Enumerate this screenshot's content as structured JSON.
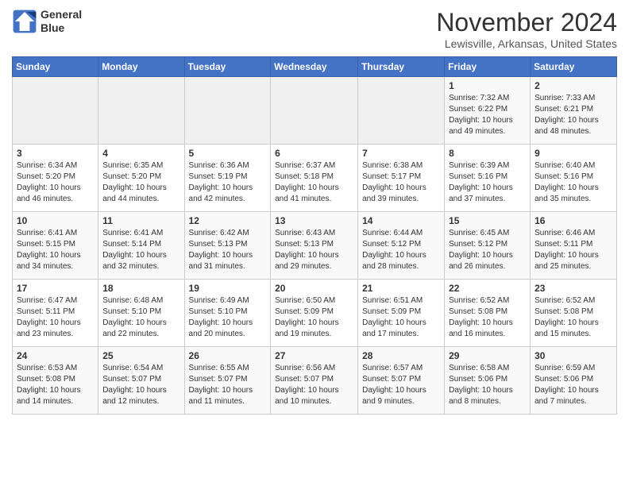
{
  "header": {
    "logo_line1": "General",
    "logo_line2": "Blue",
    "month": "November 2024",
    "location": "Lewisville, Arkansas, United States"
  },
  "weekdays": [
    "Sunday",
    "Monday",
    "Tuesday",
    "Wednesday",
    "Thursday",
    "Friday",
    "Saturday"
  ],
  "weeks": [
    [
      {
        "day": "",
        "info": ""
      },
      {
        "day": "",
        "info": ""
      },
      {
        "day": "",
        "info": ""
      },
      {
        "day": "",
        "info": ""
      },
      {
        "day": "",
        "info": ""
      },
      {
        "day": "1",
        "info": "Sunrise: 7:32 AM\nSunset: 6:22 PM\nDaylight: 10 hours\nand 49 minutes."
      },
      {
        "day": "2",
        "info": "Sunrise: 7:33 AM\nSunset: 6:21 PM\nDaylight: 10 hours\nand 48 minutes."
      }
    ],
    [
      {
        "day": "3",
        "info": "Sunrise: 6:34 AM\nSunset: 5:20 PM\nDaylight: 10 hours\nand 46 minutes."
      },
      {
        "day": "4",
        "info": "Sunrise: 6:35 AM\nSunset: 5:20 PM\nDaylight: 10 hours\nand 44 minutes."
      },
      {
        "day": "5",
        "info": "Sunrise: 6:36 AM\nSunset: 5:19 PM\nDaylight: 10 hours\nand 42 minutes."
      },
      {
        "day": "6",
        "info": "Sunrise: 6:37 AM\nSunset: 5:18 PM\nDaylight: 10 hours\nand 41 minutes."
      },
      {
        "day": "7",
        "info": "Sunrise: 6:38 AM\nSunset: 5:17 PM\nDaylight: 10 hours\nand 39 minutes."
      },
      {
        "day": "8",
        "info": "Sunrise: 6:39 AM\nSunset: 5:16 PM\nDaylight: 10 hours\nand 37 minutes."
      },
      {
        "day": "9",
        "info": "Sunrise: 6:40 AM\nSunset: 5:16 PM\nDaylight: 10 hours\nand 35 minutes."
      }
    ],
    [
      {
        "day": "10",
        "info": "Sunrise: 6:41 AM\nSunset: 5:15 PM\nDaylight: 10 hours\nand 34 minutes."
      },
      {
        "day": "11",
        "info": "Sunrise: 6:41 AM\nSunset: 5:14 PM\nDaylight: 10 hours\nand 32 minutes."
      },
      {
        "day": "12",
        "info": "Sunrise: 6:42 AM\nSunset: 5:13 PM\nDaylight: 10 hours\nand 31 minutes."
      },
      {
        "day": "13",
        "info": "Sunrise: 6:43 AM\nSunset: 5:13 PM\nDaylight: 10 hours\nand 29 minutes."
      },
      {
        "day": "14",
        "info": "Sunrise: 6:44 AM\nSunset: 5:12 PM\nDaylight: 10 hours\nand 28 minutes."
      },
      {
        "day": "15",
        "info": "Sunrise: 6:45 AM\nSunset: 5:12 PM\nDaylight: 10 hours\nand 26 minutes."
      },
      {
        "day": "16",
        "info": "Sunrise: 6:46 AM\nSunset: 5:11 PM\nDaylight: 10 hours\nand 25 minutes."
      }
    ],
    [
      {
        "day": "17",
        "info": "Sunrise: 6:47 AM\nSunset: 5:11 PM\nDaylight: 10 hours\nand 23 minutes."
      },
      {
        "day": "18",
        "info": "Sunrise: 6:48 AM\nSunset: 5:10 PM\nDaylight: 10 hours\nand 22 minutes."
      },
      {
        "day": "19",
        "info": "Sunrise: 6:49 AM\nSunset: 5:10 PM\nDaylight: 10 hours\nand 20 minutes."
      },
      {
        "day": "20",
        "info": "Sunrise: 6:50 AM\nSunset: 5:09 PM\nDaylight: 10 hours\nand 19 minutes."
      },
      {
        "day": "21",
        "info": "Sunrise: 6:51 AM\nSunset: 5:09 PM\nDaylight: 10 hours\nand 17 minutes."
      },
      {
        "day": "22",
        "info": "Sunrise: 6:52 AM\nSunset: 5:08 PM\nDaylight: 10 hours\nand 16 minutes."
      },
      {
        "day": "23",
        "info": "Sunrise: 6:52 AM\nSunset: 5:08 PM\nDaylight: 10 hours\nand 15 minutes."
      }
    ],
    [
      {
        "day": "24",
        "info": "Sunrise: 6:53 AM\nSunset: 5:08 PM\nDaylight: 10 hours\nand 14 minutes."
      },
      {
        "day": "25",
        "info": "Sunrise: 6:54 AM\nSunset: 5:07 PM\nDaylight: 10 hours\nand 12 minutes."
      },
      {
        "day": "26",
        "info": "Sunrise: 6:55 AM\nSunset: 5:07 PM\nDaylight: 10 hours\nand 11 minutes."
      },
      {
        "day": "27",
        "info": "Sunrise: 6:56 AM\nSunset: 5:07 PM\nDaylight: 10 hours\nand 10 minutes."
      },
      {
        "day": "28",
        "info": "Sunrise: 6:57 AM\nSunset: 5:07 PM\nDaylight: 10 hours\nand 9 minutes."
      },
      {
        "day": "29",
        "info": "Sunrise: 6:58 AM\nSunset: 5:06 PM\nDaylight: 10 hours\nand 8 minutes."
      },
      {
        "day": "30",
        "info": "Sunrise: 6:59 AM\nSunset: 5:06 PM\nDaylight: 10 hours\nand 7 minutes."
      }
    ]
  ]
}
